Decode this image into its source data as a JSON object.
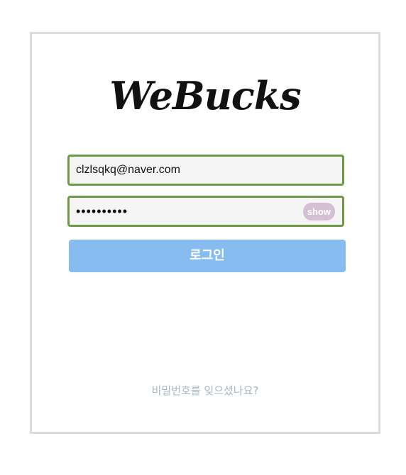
{
  "brand": {
    "logo_text": "WeBucks"
  },
  "login_form": {
    "email_value": "clzlsqkq@naver.com",
    "password_masked": "••••••••••",
    "show_label": "show",
    "submit_label": "로그인",
    "forgot_link": "비밀번호를 잊으셨나요?"
  },
  "colors": {
    "field_border": "#6e9a47",
    "submit_bg": "#86bcef",
    "show_bg": "#d5bfd5",
    "forgot_text": "#a6b5c9"
  }
}
